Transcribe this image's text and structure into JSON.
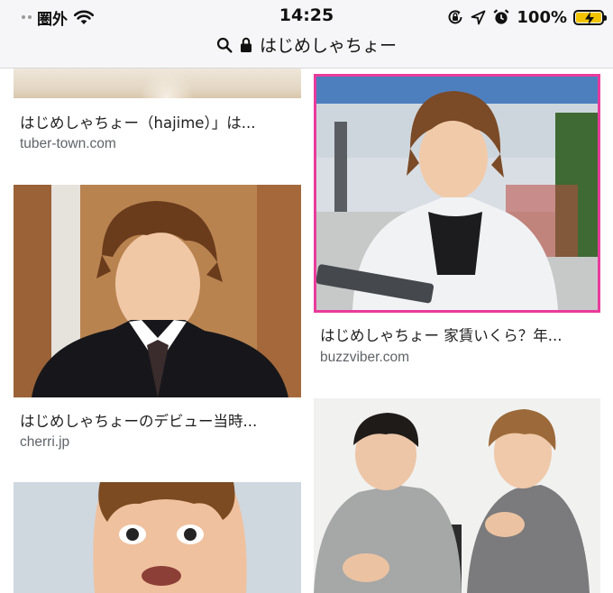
{
  "status_bar": {
    "carrier": "圏外",
    "time": "14:25",
    "battery": "100%",
    "icons": [
      "signal-dots-icon",
      "wifi-icon",
      "orientation-lock-icon",
      "location-arrow-icon",
      "alarm-clock-icon",
      "battery-charging-icon"
    ]
  },
  "search": {
    "query": "はじめしゃちょー"
  },
  "results": [
    {
      "title": "はじめしゃちょー（hajime）」は...",
      "domain": "tuber-town.com"
    },
    {
      "title": "はじめしゃちょー 家賃いくら？年...",
      "domain": "buzzviber.com"
    },
    {
      "title": "はじめしゃちょーのデビュー当時...",
      "domain": "cherri.jp"
    }
  ],
  "colors": {
    "highlight_border": "#e93b9c",
    "battery_fill": "#f2c400"
  }
}
